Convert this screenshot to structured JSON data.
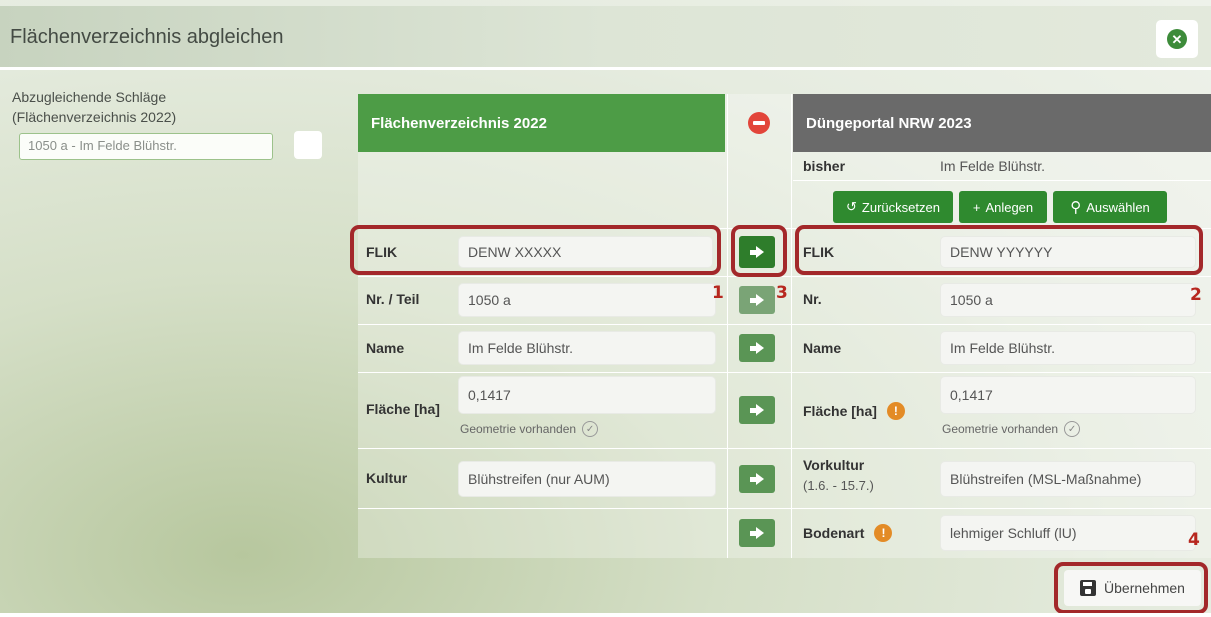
{
  "dialog": {
    "title": "Flächenverzeichnis abgleichen"
  },
  "left": {
    "label_line1": "Abzugleichende Schläge",
    "label_line2": "(Flächenverzeichnis 2022)",
    "select_value": "1050 a - Im Felde Blühstr."
  },
  "columns": {
    "left_title": "Flächenverzeichnis 2022",
    "right_title": "Düngeportal NRW 2023"
  },
  "bisher": {
    "label": "bisher",
    "value": "Im Felde Blühstr."
  },
  "actions": {
    "reset": "Zurücksetzen",
    "create": "Anlegen",
    "select": "Auswählen"
  },
  "rows": {
    "flik": {
      "left_label": "FLIK",
      "left_value": "DENW  XXXXX",
      "right_label": "FLIK",
      "right_value": "DENW  YYYYYY"
    },
    "nr": {
      "left_label": "Nr. / Teil",
      "left_value": "1050 a",
      "right_label": "Nr.",
      "right_value": "1050 a"
    },
    "name": {
      "left_label": "Name",
      "left_value": "Im Felde Blühstr.",
      "right_label": "Name",
      "right_value": "Im Felde Blühstr."
    },
    "flaeche": {
      "left_label": "Fläche [ha]",
      "left_value": "0,1417",
      "left_sub": "Geometrie vorhanden",
      "right_label": "Fläche [ha]",
      "right_value": "0,1417",
      "right_sub": "Geometrie vorhanden"
    },
    "kultur": {
      "left_label": "Kultur",
      "left_value": "Blühstreifen (nur AUM)",
      "right_label": "Vorkultur",
      "right_label_sub": "(1.6. - 15.7.)",
      "right_value": "Blühstreifen (MSL-Maßnahme)"
    },
    "boden": {
      "right_label": "Bodenart",
      "right_value": "lehmiger Schluff (lU)"
    }
  },
  "markers": {
    "m1": "1",
    "m2": "2",
    "m3": "3",
    "m4": "4"
  },
  "save": {
    "label": "Übernehmen"
  },
  "icons": {
    "close": "close-circle-icon",
    "info_glyph": "!",
    "check_glyph": "✓"
  },
  "colors": {
    "green_header": "#4d9c46",
    "gray_header": "#6a6a6a",
    "accent_green": "#2f8a2f",
    "highlight_red": "#a3282a",
    "info_orange": "#e38b26"
  }
}
